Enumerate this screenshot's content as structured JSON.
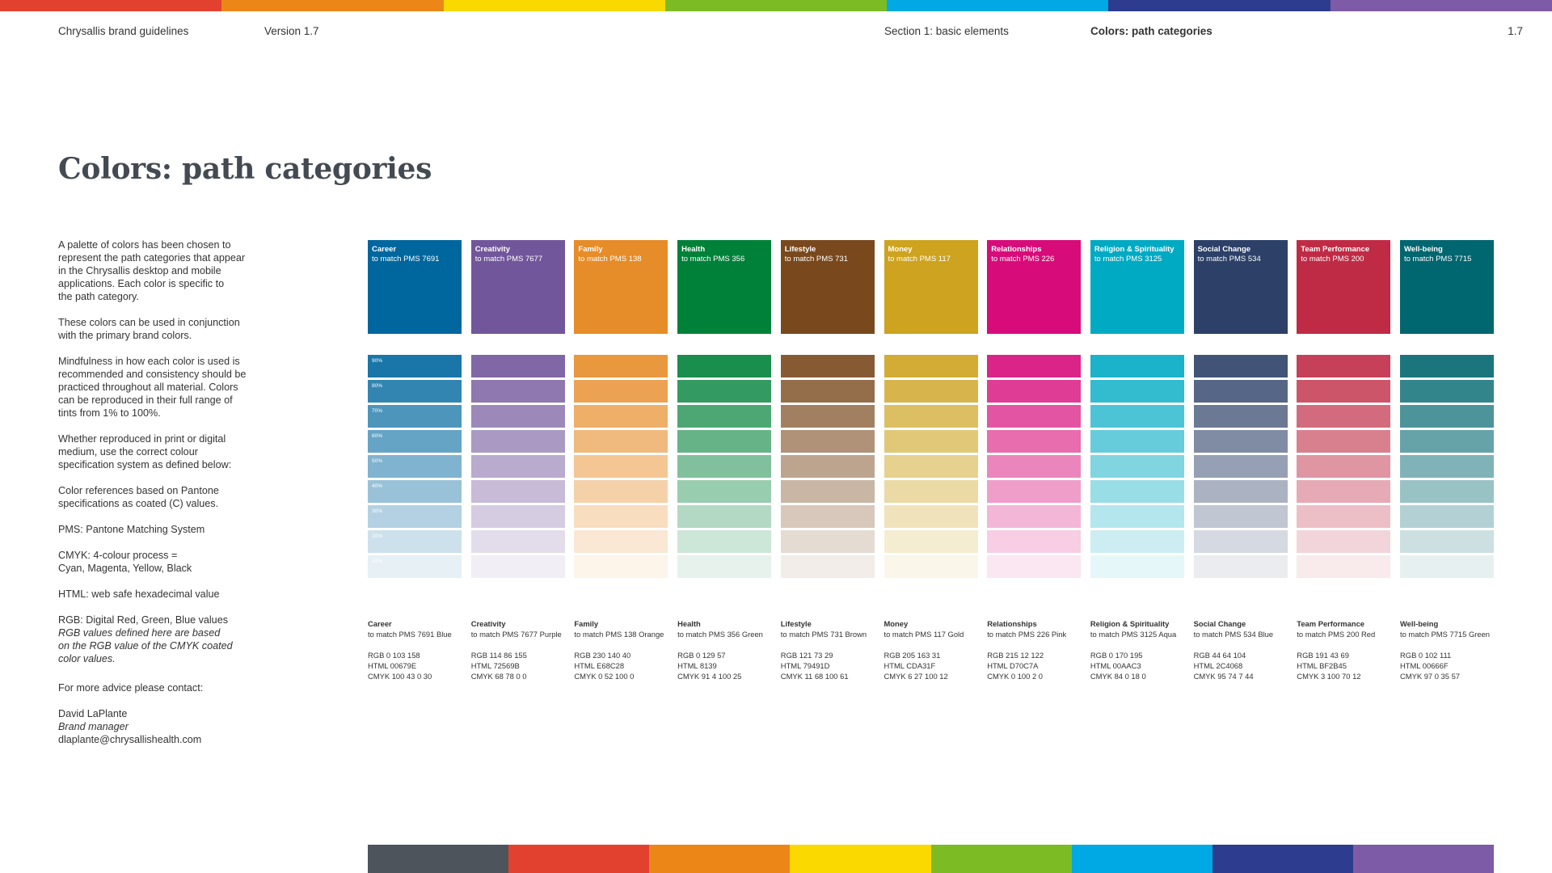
{
  "bands": {
    "top": [
      "#e3412f",
      "#ec8717",
      "#fad900",
      "#7dbb25",
      "#00a9e3",
      "#2e3c8f",
      "#7d5ba6"
    ],
    "bottom": [
      "#4d545c",
      "#e3412f",
      "#ec8717",
      "#fad900",
      "#7dbb25",
      "#00a9e3",
      "#2e3c8f",
      "#7d5ba6"
    ]
  },
  "header": {
    "brand": "Chrysallis brand guidelines",
    "version": "Version 1.7",
    "section": "Section 1: basic elements",
    "current": "Colors: path categories",
    "page": "1.7"
  },
  "title": "Colors: path categories",
  "intro": {
    "p1": "A palette of colors has been chosen to\nrepresent the path categories that appear\nin the Chrysallis desktop and mobile\napplications. Each color is specific to\nthe path category.",
    "p2": "These colors can be used in conjunction\nwith the primary brand colors.",
    "p3": "Mindfulness in how each color is used is\nrecommended and consistency should be\npracticed throughout all material. Colors\ncan be reproduced in their full range of\ntints from 1% to 100%.",
    "p4": "Whether reproduced in print or digital\nmedium, use the correct colour\nspecification system as defined below:",
    "p5": "Color references based on Pantone\nspecifications as coated (C) values.",
    "p6": "PMS: Pantone Matching System",
    "p7": "CMYK:  4-colour process =\nCyan, Magenta, Yellow, Black",
    "p8": "HTML: web safe hexadecimal value",
    "p9": "RGB: Digital Red, Green, Blue values",
    "p10": "RGB values defined here are based\non the RGB value of the CMYK coated\ncolor values.",
    "contact_intro": "For more advice please contact:",
    "contact_name": "David LaPlante",
    "contact_role": "Brand manager",
    "contact_email": "dlaplante@chrysallishealth.com"
  },
  "tint_labels": [
    "90%",
    "80%",
    "70%",
    "60%",
    "50%",
    "40%",
    "30%",
    "20%",
    "10%"
  ],
  "tint_levels": [
    0.9,
    0.8,
    0.7,
    0.6,
    0.5,
    0.4,
    0.3,
    0.2,
    0.1
  ],
  "categories": [
    {
      "name": "Career",
      "pms": "to match PMS 7691",
      "pms_full": "to match PMS 7691 Blue",
      "rgb": "RGB  0  103  158",
      "html": "HTML  00679E",
      "cmyk": "CMYK  100  43  0  30",
      "color": "#00679E"
    },
    {
      "name": "Creativity",
      "pms": "to match PMS 7677",
      "pms_full": "to match PMS 7677 Purple",
      "rgb": "RGB  114  86  155",
      "html": "HTML  72569B",
      "cmyk": "CMYK  68  78  0  0",
      "color": "#72569B"
    },
    {
      "name": "Family",
      "pms": "to match PMS 138",
      "pms_full": "to match PMS 138 Orange",
      "rgb": "RGB  230  140  40",
      "html": "HTML  E68C28",
      "cmyk": "CMYK  0  52  100  0",
      "color": "#E68C28"
    },
    {
      "name": "Health",
      "pms": "to match PMS 356",
      "pms_full": "to match PMS 356 Green",
      "rgb": "RGB  0  129  57",
      "html": "HTML  8139",
      "cmyk": "CMYK  91  4  100  25",
      "color": "#008139"
    },
    {
      "name": "Lifestyle",
      "pms": "to match PMS 731",
      "pms_full": "to match PMS 731 Brown",
      "rgb": "RGB  121  73  29",
      "html": "HTML  79491D",
      "cmyk": "CMYK  11  68  100  61",
      "color": "#79491D"
    },
    {
      "name": "Money",
      "pms": "to match PMS 117",
      "pms_full": "to match PMS 117 Gold",
      "rgb": "RGB  205  163  31",
      "html": "HTML  CDA31F",
      "cmyk": "CMYK  6  27  100  12",
      "color": "#CDA31F"
    },
    {
      "name": "Relationships",
      "pms": "to match PMS 226",
      "pms_full": "to match PMS 226 Pink",
      "rgb": "RGB  215  12  122",
      "html": "HTML  D70C7A",
      "cmyk": "CMYK  0  100  2  0",
      "color": "#D70C7A"
    },
    {
      "name": "Religion & Spirituality",
      "pms": "to match PMS 3125",
      "pms_full": "to match PMS 3125 Aqua",
      "rgb": "RGB  0  170  195",
      "html": "HTML  00AAC3",
      "cmyk": "CMYK  84  0  18  0",
      "color": "#00AAC3"
    },
    {
      "name": "Social Change",
      "pms": "to match PMS 534",
      "pms_full": "to match PMS 534 Blue",
      "rgb": "RGB  44  64  104",
      "html": "HTML  2C4068",
      "cmyk": "CMYK  95  74  7  44",
      "color": "#2C4068"
    },
    {
      "name": "Team Performance",
      "pms": "to match PMS 200",
      "pms_full": "to match PMS 200 Red",
      "rgb": "RGB  191  43  69",
      "html": "HTML  BF2B45",
      "cmyk": "CMYK  3  100  70  12",
      "color": "#BF2B45"
    },
    {
      "name": "Well-being",
      "pms": "to match PMS 7715",
      "pms_full": "to match PMS 7715 Green",
      "rgb": "RGB  0  102  111",
      "html": "HTML  00666F",
      "cmyk": "CMYK  97  0  35  57",
      "color": "#00666F"
    }
  ]
}
